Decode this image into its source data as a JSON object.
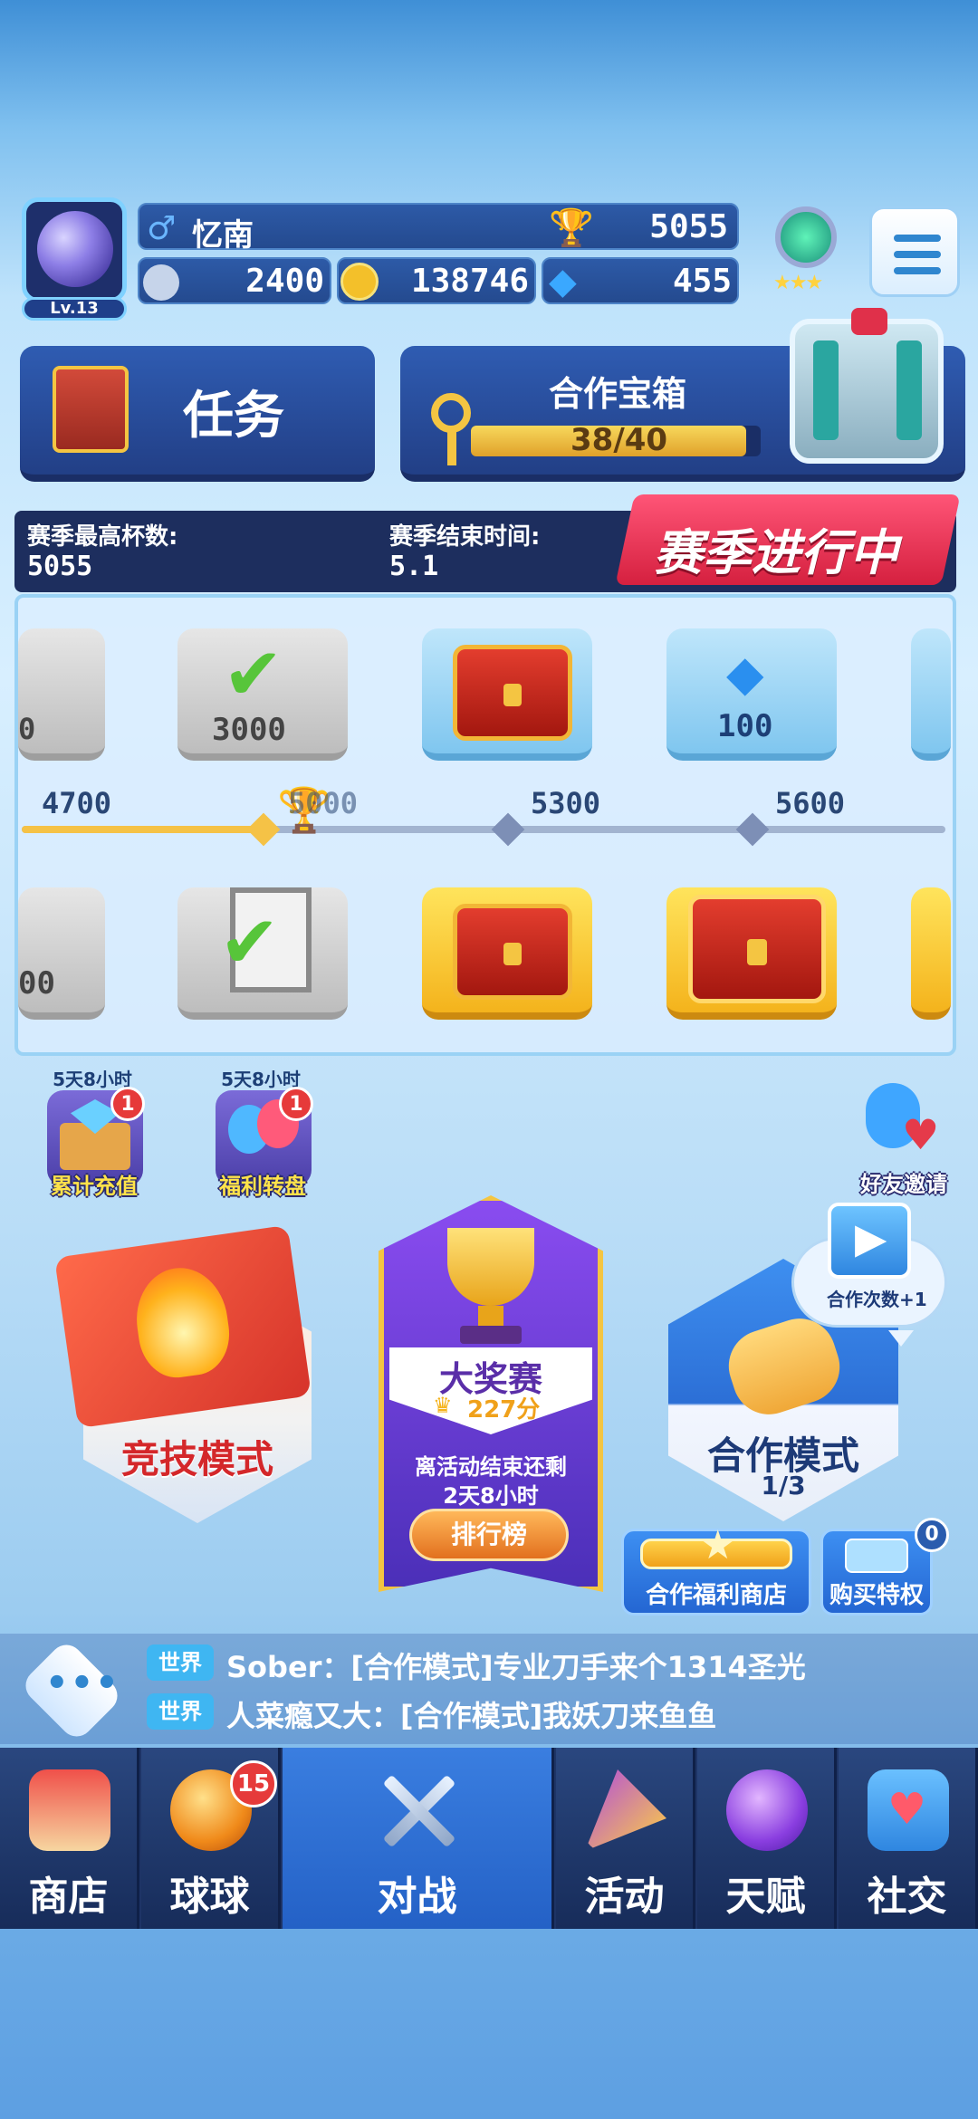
{
  "player": {
    "name": "忆南",
    "gender_icon": "male-icon",
    "level": "Lv.13",
    "trophies": "5055",
    "energy": "2400",
    "coins": "138746",
    "gems": "455"
  },
  "tasks": {
    "label": "任务"
  },
  "coop_chest": {
    "title": "合作宝箱",
    "progress_text": "38/40",
    "progress": 0.95
  },
  "season": {
    "best_label": "赛季最高杯数:",
    "best_value": "5055",
    "end_label": "赛季结束时间:",
    "end_value": "5.1",
    "status": "赛季进行中"
  },
  "track": {
    "milestones": [
      "4700",
      "5000",
      "5300",
      "5600"
    ],
    "top_rewards": [
      "0",
      "3000",
      "",
      "100"
    ],
    "bottom_rewards": [
      "00",
      "",
      "",
      ""
    ]
  },
  "events": [
    {
      "time": "5天8小时",
      "label": "累计充值",
      "badge": "1"
    },
    {
      "time": "5天8小时",
      "label": "福利转盘",
      "badge": "1"
    }
  ],
  "invite": {
    "label": "好友邀请"
  },
  "modes": {
    "competitive": {
      "label": "竞技模式"
    },
    "grand_prix": {
      "title": "大奖赛",
      "score": "227分",
      "remain_line1": "离活动结束还剩",
      "remain_line2": "2天8小时",
      "rank_button": "排行榜"
    },
    "coop": {
      "label": "合作模式",
      "count": "1/3",
      "bonus": "合作次数+1"
    }
  },
  "shop_buttons": {
    "coop_shop": "合作福利商店",
    "buy_privilege": "购买特权",
    "privilege_badge": "0"
  },
  "chat": [
    {
      "tag": "世界",
      "text": "Sober：[合作模式]专业刀手来个1314圣光"
    },
    {
      "tag": "世界",
      "text": "人菜瘾又大：[合作模式]我妖刀来鱼鱼"
    }
  ],
  "nav": [
    {
      "label": "商店"
    },
    {
      "label": "球球",
      "badge": "15"
    },
    {
      "label": "对战"
    },
    {
      "label": "活动"
    },
    {
      "label": "天赋"
    },
    {
      "label": "社交"
    }
  ],
  "colors": {
    "accent_gold": "#f5c246",
    "panel_blue": "#2f5cb2",
    "active_tab": "#3a7ee0",
    "badge_red": "#e63a3a"
  }
}
